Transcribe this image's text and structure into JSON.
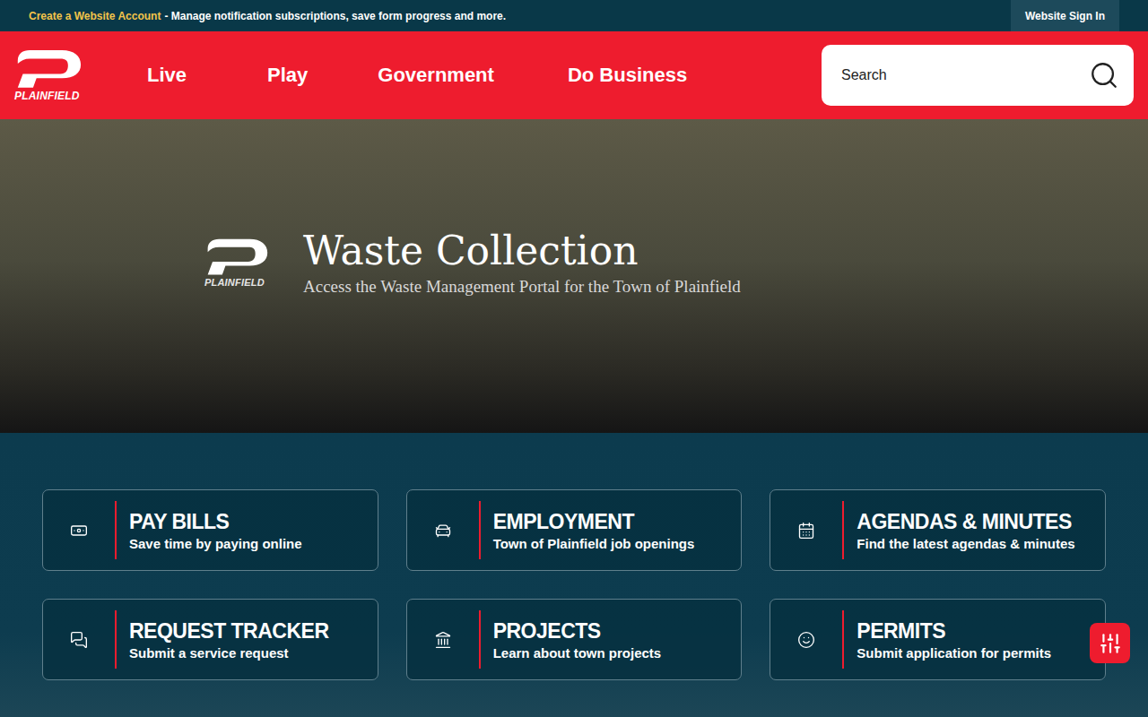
{
  "topbar": {
    "link": "Create a Website Account",
    "message": "- Manage notification subscriptions, save form progress and more.",
    "sign_in": "Website Sign In"
  },
  "logo": {
    "name": "PLAINFIELD"
  },
  "nav": {
    "items": [
      {
        "label": "Live"
      },
      {
        "label": "Play"
      },
      {
        "label": "Government"
      },
      {
        "label": "Do Business"
      }
    ]
  },
  "search": {
    "placeholder": "Search"
  },
  "hero": {
    "title": "Waste Collection",
    "subtitle": "Access the Waste Management Portal for the Town of Plainfield"
  },
  "cards": [
    {
      "title": "PAY BILLS",
      "subtitle": "Save time by paying online"
    },
    {
      "title": "EMPLOYMENT",
      "subtitle": "Town of Plainfield job openings"
    },
    {
      "title": "AGENDAS & MINUTES",
      "subtitle": "Find the latest agendas & minutes"
    },
    {
      "title": "REQUEST TRACKER",
      "subtitle": "Submit a service request"
    },
    {
      "title": "PROJECTS",
      "subtitle": "Learn about town projects"
    },
    {
      "title": "PERMITS",
      "subtitle": "Submit application for permits"
    }
  ]
}
